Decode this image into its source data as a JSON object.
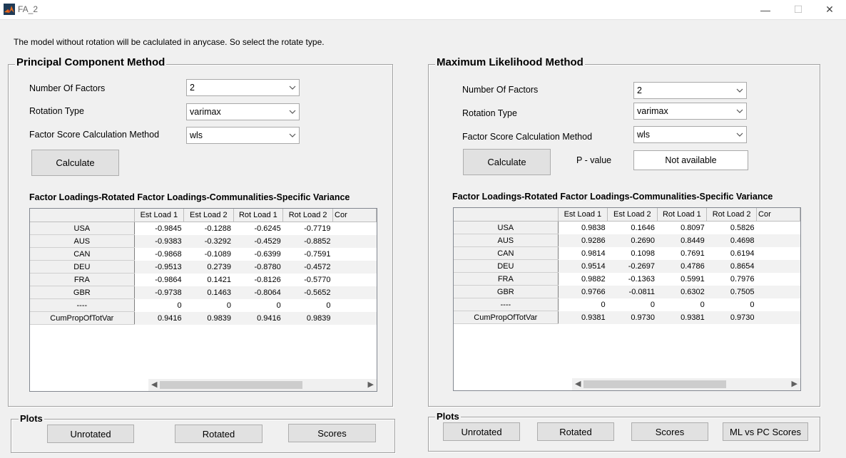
{
  "window": {
    "title": "FA_2",
    "minimize": "—",
    "maximize": "☐",
    "close": "✕"
  },
  "info_text": "The model without rotation will be caclulated in anycase. So select the rotate type.",
  "pc": {
    "title": "Principal Component Method",
    "labels": {
      "factors": "Number Of Factors",
      "rotation": "Rotation Type",
      "score": "Factor Score Calculation Method"
    },
    "values": {
      "factors": "2",
      "rotation": "varimax",
      "score": "wls"
    },
    "calculate": "Calculate",
    "table_title": "Factor Loadings-Rotated Factor Loadings-Communalities-Specific Variance",
    "columns": [
      "Est Load 1",
      "Est Load 2",
      "Rot Load 1",
      "Rot Load 2",
      "Cor"
    ],
    "rows": [
      {
        "name": "USA",
        "v": [
          "-0.9845",
          "-0.1288",
          "-0.6245",
          "-0.7719"
        ]
      },
      {
        "name": "AUS",
        "v": [
          "-0.9383",
          "-0.3292",
          "-0.4529",
          "-0.8852"
        ]
      },
      {
        "name": "CAN",
        "v": [
          "-0.9868",
          "-0.1089",
          "-0.6399",
          "-0.7591"
        ]
      },
      {
        "name": "DEU",
        "v": [
          "-0.9513",
          "0.2739",
          "-0.8780",
          "-0.4572"
        ]
      },
      {
        "name": "FRA",
        "v": [
          "-0.9864",
          "0.1421",
          "-0.8126",
          "-0.5770"
        ]
      },
      {
        "name": "GBR",
        "v": [
          "-0.9738",
          "0.1463",
          "-0.8064",
          "-0.5652"
        ]
      },
      {
        "name": "----",
        "v": [
          "0",
          "0",
          "0",
          "0"
        ]
      },
      {
        "name": "CumPropOfTotVar",
        "v": [
          "0.9416",
          "0.9839",
          "0.9416",
          "0.9839"
        ]
      }
    ],
    "plots_title": "Plots",
    "plots": {
      "unrotated": "Unrotated",
      "rotated": "Rotated",
      "scores": "Scores"
    }
  },
  "ml": {
    "title": "Maximum Likelihood Method",
    "labels": {
      "factors": "Number Of Factors",
      "rotation": "Rotation Type",
      "score": "Factor Score Calculation Method"
    },
    "values": {
      "factors": "2",
      "rotation": "varimax",
      "score": "wls"
    },
    "calculate": "Calculate",
    "pvalue_label": "P - value",
    "pvalue": "Not available",
    "table_title": "Factor Loadings-Rotated Factor Loadings-Communalities-Specific Variance",
    "columns": [
      "Est Load 1",
      "Est Load 2",
      "Rot Load 1",
      "Rot Load 2",
      "Cor"
    ],
    "rows": [
      {
        "name": "USA",
        "v": [
          "0.9838",
          "0.1646",
          "0.8097",
          "0.5826"
        ]
      },
      {
        "name": "AUS",
        "v": [
          "0.9286",
          "0.2690",
          "0.8449",
          "0.4698"
        ]
      },
      {
        "name": "CAN",
        "v": [
          "0.9814",
          "0.1098",
          "0.7691",
          "0.6194"
        ]
      },
      {
        "name": "DEU",
        "v": [
          "0.9514",
          "-0.2697",
          "0.4786",
          "0.8654"
        ]
      },
      {
        "name": "FRA",
        "v": [
          "0.9882",
          "-0.1363",
          "0.5991",
          "0.7976"
        ]
      },
      {
        "name": "GBR",
        "v": [
          "0.9766",
          "-0.0811",
          "0.6302",
          "0.7505"
        ]
      },
      {
        "name": "----",
        "v": [
          "0",
          "0",
          "0",
          "0"
        ]
      },
      {
        "name": "CumPropOfTotVar",
        "v": [
          "0.9381",
          "0.9730",
          "0.9381",
          "0.9730"
        ]
      }
    ],
    "plots_title": "Plots",
    "plots": {
      "unrotated": "Unrotated",
      "rotated": "Rotated",
      "scores": "Scores",
      "ml_vs_pc": "ML vs PC Scores"
    }
  }
}
